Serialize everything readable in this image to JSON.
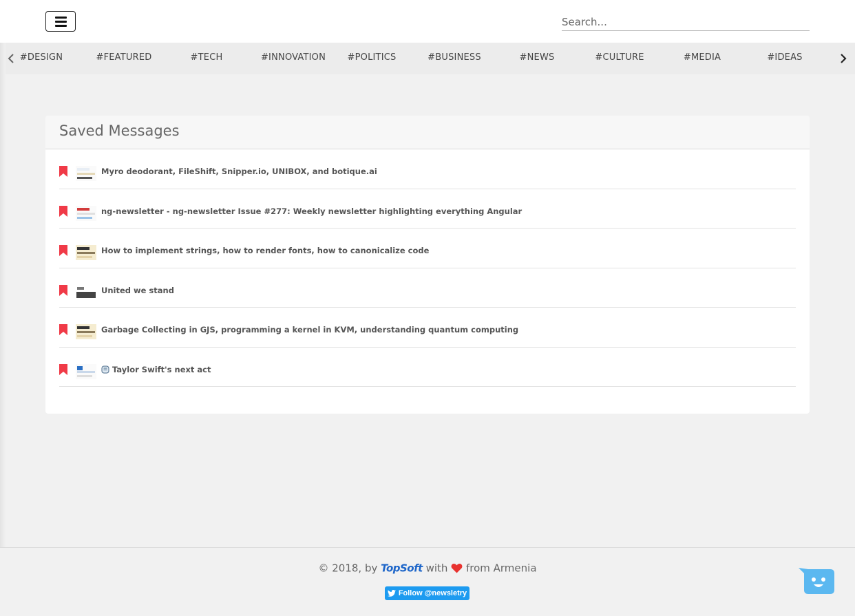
{
  "header": {
    "menu_icon": "hamburger-icon",
    "search": {
      "placeholder": "Search...",
      "value": ""
    }
  },
  "tags": {
    "prev_icon": "chevron-left-icon",
    "next_icon": "chevron-right-icon",
    "items": [
      "#DESIGN",
      "#FEATURED",
      "#TECH",
      "#INNOVATION",
      "#POLITICS",
      "#BUSINESS",
      "#NEWS",
      "#CULTURE",
      "#MEDIA",
      "#IDEAS"
    ]
  },
  "saved": {
    "title": "Saved Messages",
    "bookmark_icon": "bookmark-icon",
    "bookmark_color": "#f03a47",
    "items": [
      {
        "title": "Myro deodorant, FileShift, Snipper.io, UNIBOX, and botique.ai"
      },
      {
        "title": "ng-newsletter - ng-newsletter Issue #277: Weekly newsletter highlighting everything Angular"
      },
      {
        "title": "How to implement strings, how to render fonts, how to canonicalize code"
      },
      {
        "title": "United we stand"
      },
      {
        "title": "Garbage Collecting in GJS, programming a kernel in KVM, understanding quantum computing"
      },
      {
        "title": "Taylor Swift's next act",
        "prefix_icon": "newspaper-emoji-icon"
      }
    ]
  },
  "footer": {
    "copyright": "© 2018, by",
    "logo": "TopSoft",
    "with": "with",
    "from": "from Armenia",
    "heart_icon": "heart-icon",
    "heart_color": "#e8322f",
    "follow_label": "Follow @newsletry",
    "twitter_icon": "twitter-bird-icon"
  },
  "chat": {
    "icon": "chat-bot-icon",
    "color": "#5bb8f0"
  }
}
